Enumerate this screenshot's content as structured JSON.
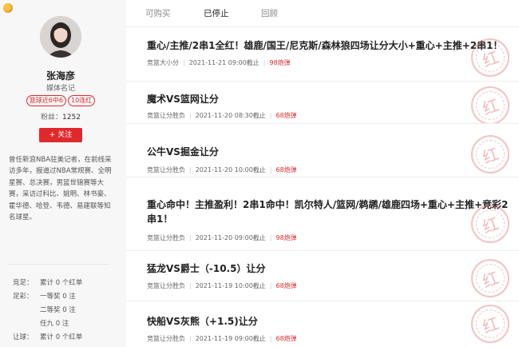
{
  "profile": {
    "name": "张海彦",
    "title": "媒体名记",
    "badges": [
      "篮球近6中6",
      "10连红"
    ],
    "fans_label": "粉丝：",
    "fans_count": "1252",
    "follow_label": "+ 关注",
    "bio": "曾任新浪NBA驻美记者，在前线采访多年，报道过NBA常规赛、全明星赛、总决赛，男篮世锦赛等大赛，采访过科比、姚明、林书豪、霍华德、哈登、韦德、易建联等知名球星。"
  },
  "stats": [
    {
      "label": "竞足：",
      "value": "累计 0 个红单"
    },
    {
      "label": "足彩：",
      "value": "一等奖 0 注"
    },
    {
      "label": "",
      "value": "二等奖 0 注"
    },
    {
      "label": "",
      "value": "任九 0 注"
    },
    {
      "label": "让球：",
      "value": "累计 0 个红单"
    }
  ],
  "tabs": [
    {
      "label": "可购买",
      "active": false
    },
    {
      "label": "已停止",
      "active": true
    },
    {
      "label": "回顾",
      "active": false
    }
  ],
  "items": [
    {
      "title": "重心/主推/2串1全红！雄鹿/国王/尼克斯/森林狼四场让分大小+重心+主推+2串1！",
      "category": "竞篮大小分",
      "time": "2021-11-21 09:00截止",
      "price": "98炮弹"
    },
    {
      "title": "魔术VS篮网让分",
      "category": "竞篮让分胜负",
      "time": "2021-11-20 08:30截止",
      "price": "68炮弹"
    },
    {
      "title": "公牛VS掘金让分",
      "category": "竞篮让分胜负",
      "time": "2021-11-20 10:00截止",
      "price": "68炮弹"
    },
    {
      "title": "重心命中！主推盈利！2串1命中！凯尔特人/篮网/鹈鹕/雄鹿四场+重心+主推+竞彩2串1！",
      "category": "竞篮让分胜负",
      "time": "2021-11-20 09:00截止",
      "price": "98炮弹"
    },
    {
      "title": "猛龙VS爵士（-10.5）让分",
      "category": "竞篮让分胜负",
      "time": "2021-11-19 10:00截止",
      "price": "68炮弹"
    },
    {
      "title": "快船VS灰熊（+1.5)让分",
      "category": "竞篮让分胜负",
      "time": "2021-11-19 09:00截止",
      "price": "68炮弹"
    }
  ],
  "stamp_text": "红",
  "colors": {
    "accent": "#e0292d",
    "sidebar_bg": "#f7f7f7"
  }
}
